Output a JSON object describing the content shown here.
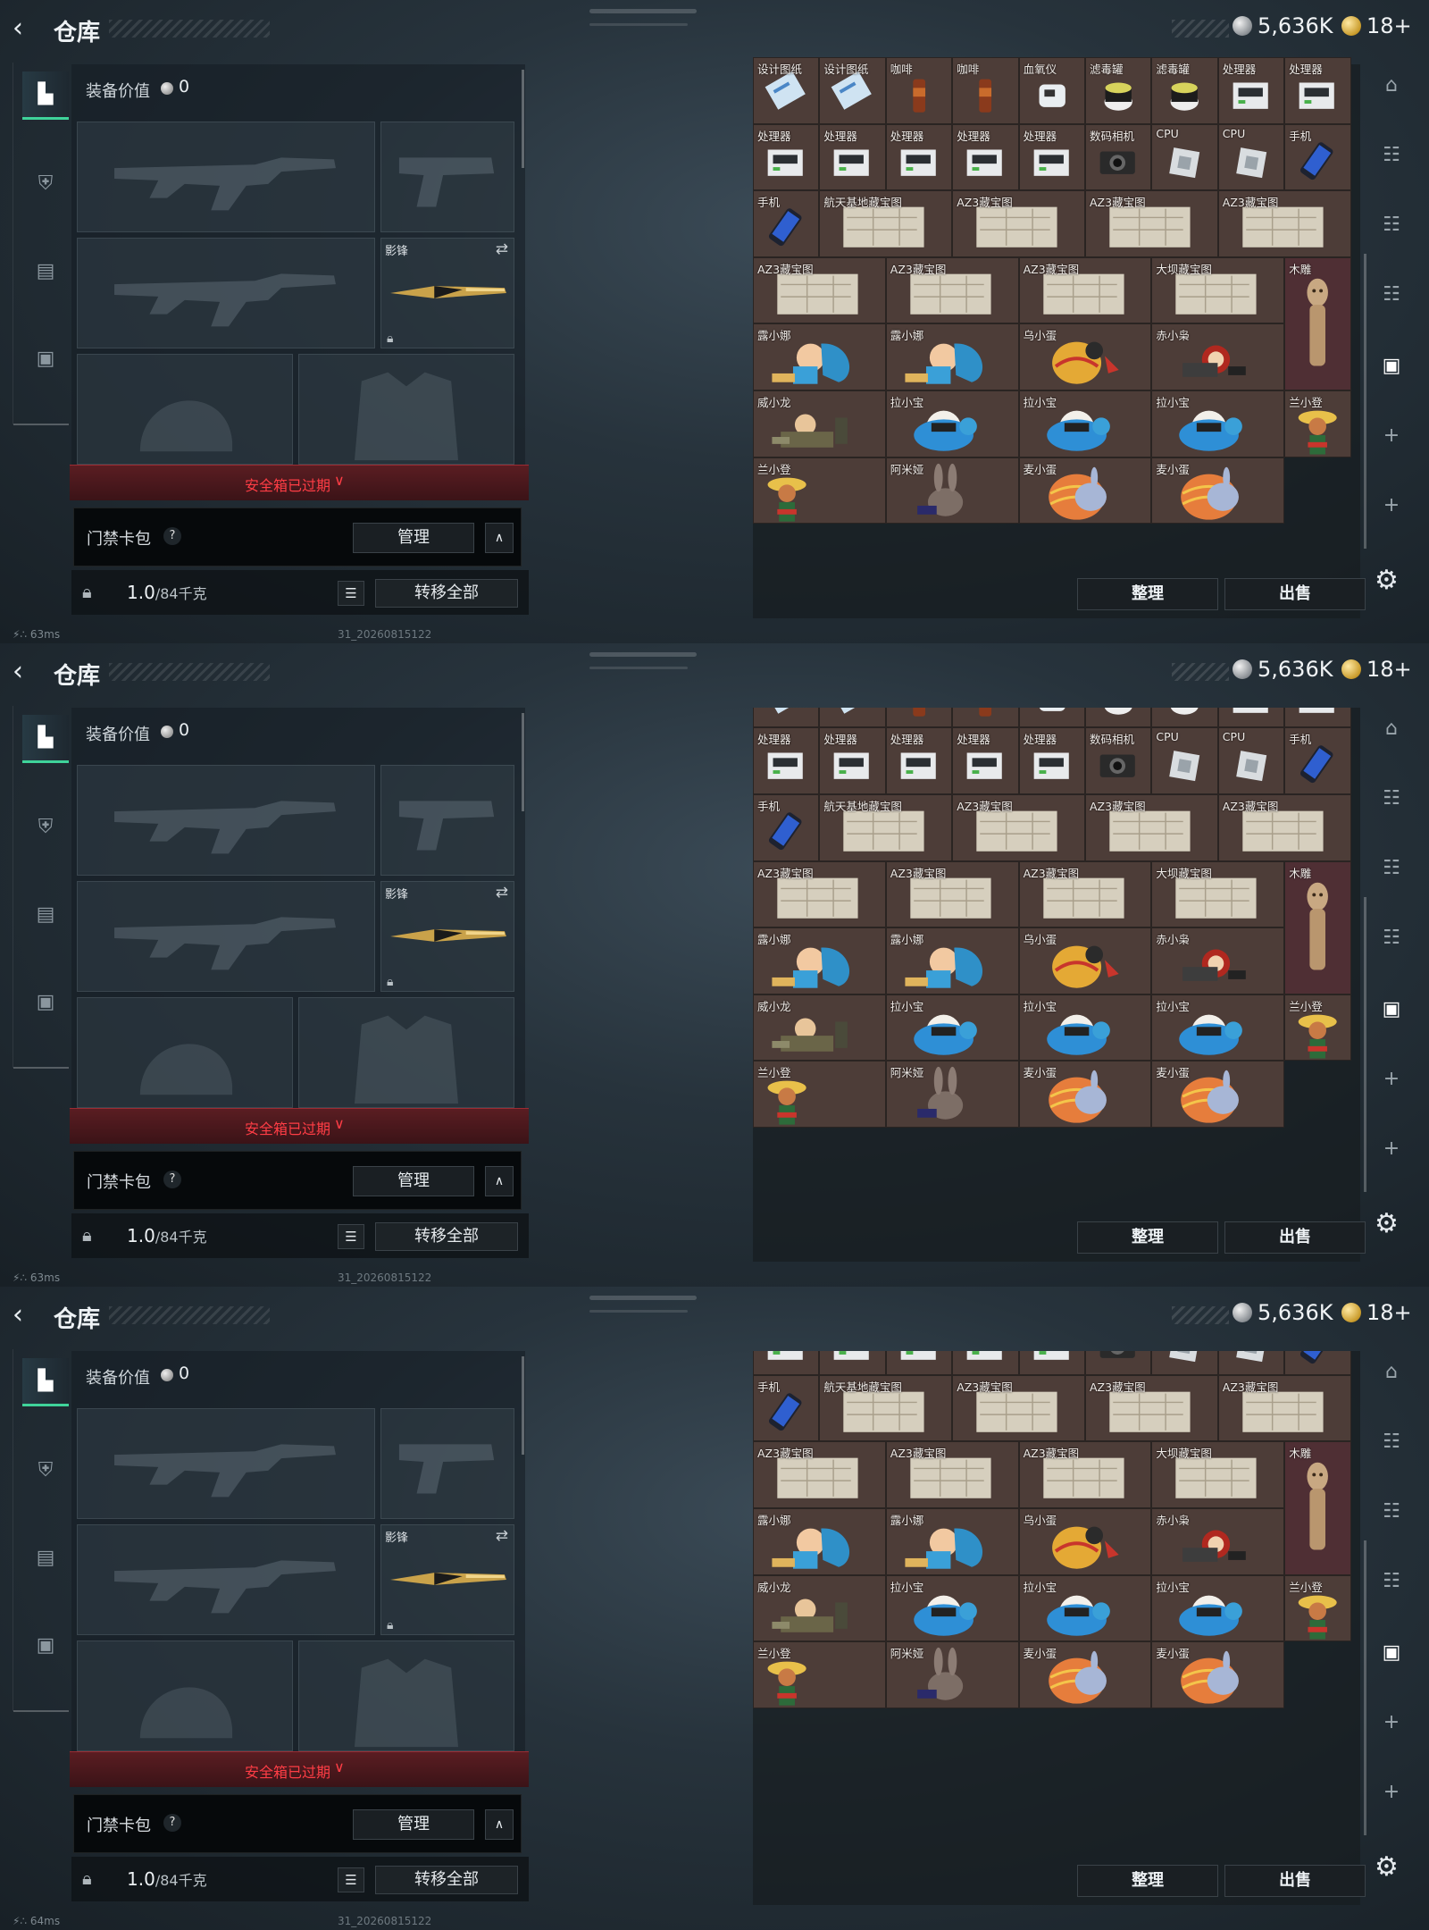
{
  "header": {
    "back_icon": "back-arrow-icon",
    "title": "仓库"
  },
  "currency": {
    "silver": "5,636K",
    "gold": "18+"
  },
  "sidenav": {
    "items": [
      "pistol-icon",
      "armor-icon",
      "backpack-icon",
      "briefcase-icon"
    ],
    "active": 0
  },
  "equipment": {
    "value_label": "装备价值",
    "value": "0",
    "melee_name": "影锋",
    "safe_status": "安全箱已过期",
    "card_pack_label": "门禁卡包",
    "help": "?",
    "manage_btn": "管理",
    "weight": "1.0",
    "weight_unit": "/84千克",
    "transfer_btn": "转移全部"
  },
  "stash": {
    "sort_btn": "整理",
    "sell_btn": "出售",
    "rows": [
      {
        "row": "r0",
        "items": [
          {
            "name": "设计图纸",
            "icon": "blueprint",
            "w": 1
          },
          {
            "name": "设计图纸",
            "icon": "blueprint",
            "w": 1
          },
          {
            "name": "咖啡",
            "icon": "coffee",
            "w": 1
          },
          {
            "name": "咖啡",
            "icon": "coffee",
            "w": 1
          },
          {
            "name": "血氧仪",
            "icon": "oximeter",
            "w": 1
          },
          {
            "name": "滤毒罐",
            "icon": "canister",
            "w": 1
          },
          {
            "name": "滤毒罐",
            "icon": "canister",
            "w": 1
          },
          {
            "name": "处理器",
            "icon": "processor",
            "w": 1
          },
          {
            "name": "处理器",
            "icon": "processor",
            "w": 1
          }
        ]
      },
      {
        "row": "r1",
        "items": [
          {
            "name": "处理器",
            "icon": "processor",
            "w": 1
          },
          {
            "name": "处理器",
            "icon": "processor",
            "w": 1
          },
          {
            "name": "处理器",
            "icon": "processor",
            "w": 1
          },
          {
            "name": "处理器",
            "icon": "processor",
            "w": 1
          },
          {
            "name": "处理器",
            "icon": "processor",
            "w": 1
          },
          {
            "name": "数码相机",
            "icon": "camera",
            "w": 1
          },
          {
            "name": "CPU",
            "icon": "cpu",
            "w": 1
          },
          {
            "name": "CPU",
            "icon": "cpu",
            "w": 1
          },
          {
            "name": "手机",
            "icon": "phone",
            "w": 1
          }
        ]
      },
      {
        "row": "r2",
        "items": [
          {
            "name": "手机",
            "icon": "phone",
            "w": 1
          },
          {
            "name": "航天基地藏宝图",
            "icon": "map",
            "w": 2
          },
          {
            "name": "AZ3藏宝图",
            "icon": "map",
            "w": 2
          },
          {
            "name": "AZ3藏宝图",
            "icon": "map",
            "w": 2
          },
          {
            "name": "AZ3藏宝图",
            "icon": "map",
            "w": 2
          }
        ]
      },
      {
        "row": "r3",
        "items": [
          {
            "name": "AZ3藏宝图",
            "icon": "map",
            "w": 2
          },
          {
            "name": "AZ3藏宝图",
            "icon": "map",
            "w": 2
          },
          {
            "name": "AZ3藏宝图",
            "icon": "map",
            "w": 2
          },
          {
            "name": "大坝藏宝图",
            "icon": "map",
            "w": 2
          },
          {
            "name": "木雕",
            "icon": "carving",
            "w": 1,
            "tall": true
          }
        ]
      },
      {
        "row": "r4",
        "items": [
          {
            "name": "露小娜",
            "icon": "doll",
            "w": 2
          },
          {
            "name": "露小娜",
            "icon": "doll",
            "w": 2
          },
          {
            "name": "乌小蛋",
            "icon": "egg",
            "w": 2
          },
          {
            "name": "赤小枭",
            "icon": "bird",
            "w": 2
          }
        ]
      },
      {
        "row": "r5",
        "items": [
          {
            "name": "威小龙",
            "icon": "soldier",
            "w": 2
          },
          {
            "name": "拉小宝",
            "icon": "blue-doll",
            "w": 2
          },
          {
            "name": "拉小宝",
            "icon": "blue-doll",
            "w": 2
          },
          {
            "name": "拉小宝",
            "icon": "blue-doll",
            "w": 2
          },
          {
            "name": "兰小登",
            "icon": "mariachi",
            "w": 1
          }
        ]
      },
      {
        "row": "r6",
        "items": [
          {
            "name": "兰小登",
            "icon": "mariachi",
            "w": 2
          },
          {
            "name": "阿米娅",
            "icon": "bunny",
            "w": 2
          },
          {
            "name": "麦小蛋",
            "icon": "easter-egg",
            "w": 2
          },
          {
            "name": "麦小蛋",
            "icon": "easter-egg",
            "w": 2
          }
        ]
      }
    ]
  },
  "status": {
    "frames": [
      {
        "ping": "63ms",
        "version": "31_20260815122"
      },
      {
        "ping": "63ms",
        "version": "31_20260815122"
      },
      {
        "ping": "64ms",
        "version": "31_20260815122"
      }
    ]
  },
  "scroll_offsets": [
    0,
    1,
    2
  ],
  "colors": {
    "accent_green": "#3fd39a",
    "alert_red": "#ff3d45",
    "cell_brown": "#4d3d38"
  }
}
